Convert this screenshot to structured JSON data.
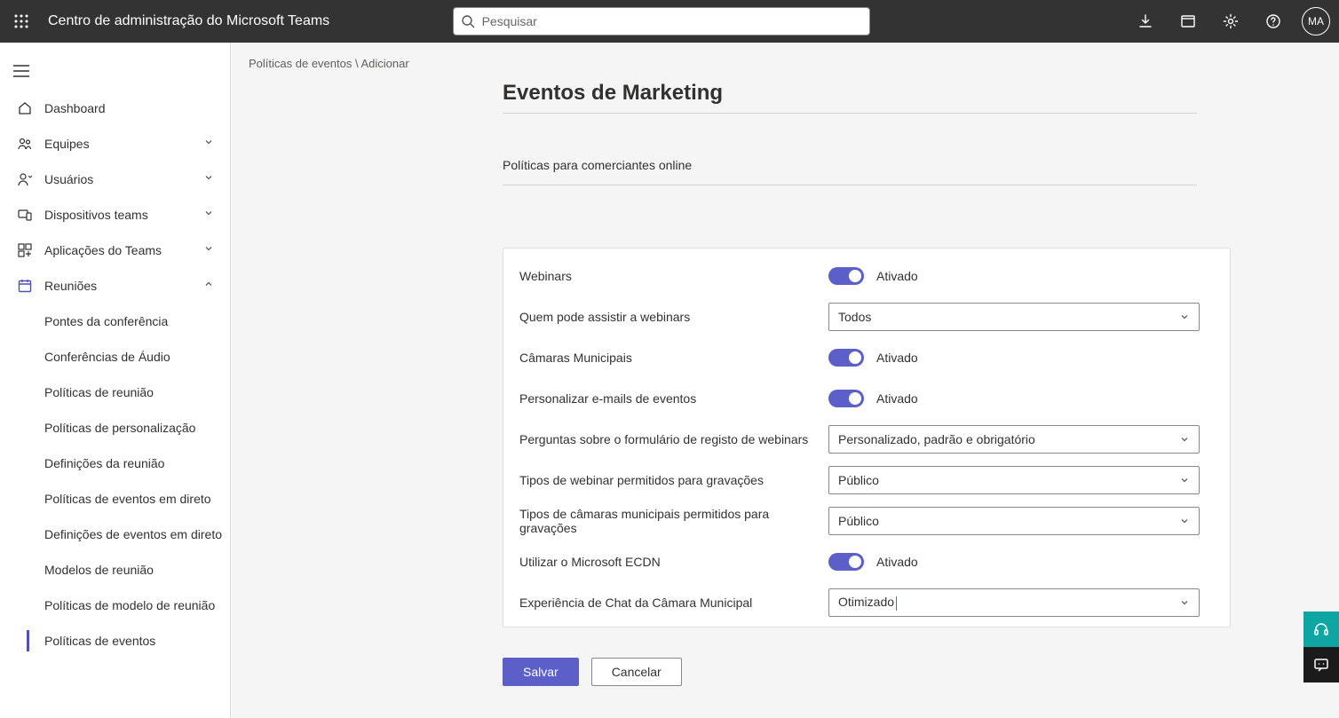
{
  "topbar": {
    "title": "Centro de administração do Microsoft Teams",
    "search_placeholder": "Pesquisar",
    "avatar_initials": "MA"
  },
  "sidebar": {
    "dashboard": "Dashboard",
    "equipes": "Equipes",
    "usuarios": "Usuários",
    "dispositivos": "Dispositivos teams",
    "aplicacoes": "Aplicações do Teams",
    "reunioes": "Reuniões",
    "sub": {
      "pontes": "Pontes da conferência",
      "conferencias_audio": "Conferências de Áudio",
      "politicas_reuniao": "Políticas de reunião",
      "politicas_personalizacao": "Políticas de personalização",
      "definicoes_reuniao": "Definições da reunião",
      "politicas_eventos_direto": "Políticas de eventos em direto",
      "definicoes_eventos_direto": "Definições de eventos em direto",
      "modelos_reuniao": "Modelos de reunião",
      "politicas_modelo_reuniao": "Políticas de modelo de reunião",
      "politicas_eventos": "Políticas de eventos"
    }
  },
  "breadcrumb": {
    "parent": "Políticas de eventos",
    "current": "Adicionar"
  },
  "page": {
    "title": "Eventos de Marketing",
    "description": "Políticas para comerciantes online"
  },
  "settings": {
    "webinars": {
      "label": "Webinars",
      "state": "Ativado"
    },
    "who_can_attend": {
      "label": "Quem pode assistir a webinars",
      "value": "Todos"
    },
    "town_halls": {
      "label": "Câmaras Municipais",
      "state": "Ativado"
    },
    "customize_emails": {
      "label": "Personalizar e-mails de eventos",
      "state": "Ativado"
    },
    "registration_questions": {
      "label": "Perguntas sobre o formulário de registo de webinars",
      "value": "Personalizado, padrão e obrigatório"
    },
    "webinar_recording_types": {
      "label": "Tipos de webinar permitidos para gravações",
      "value": "Público"
    },
    "townhall_recording_types": {
      "label": "Tipos de câmaras municipais permitidos para gravações",
      "value": "Público"
    },
    "use_ecdn": {
      "label": "Utilizar o Microsoft ECDN",
      "state": "Ativado"
    },
    "townhall_chat": {
      "label": "Experiência de Chat da Câmara Municipal",
      "value": "Otimizado"
    }
  },
  "buttons": {
    "save": "Salvar",
    "cancel": "Cancelar"
  }
}
